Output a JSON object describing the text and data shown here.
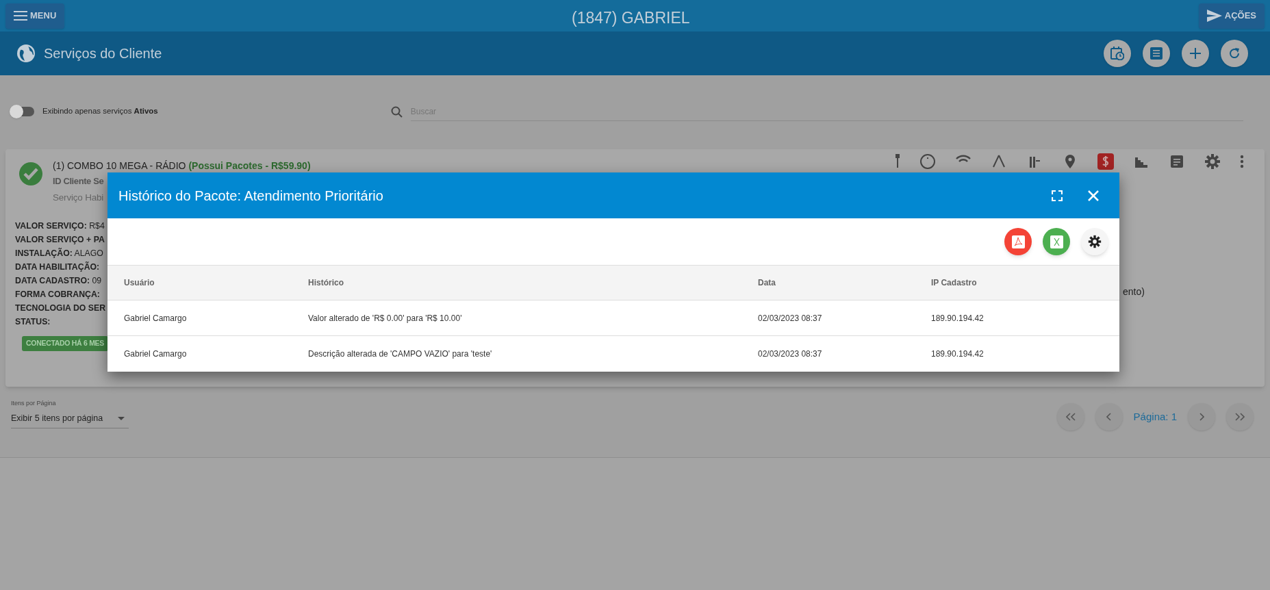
{
  "top_bar": {
    "menu_button": "MENU",
    "title": "(1847) GABRIEL",
    "actions_button": "AÇÕES"
  },
  "header": {
    "title": "Serviços do Cliente"
  },
  "filter": {
    "toggle": {
      "on": false
    },
    "label": "Exibindo apenas serviços **Ativos**",
    "search": {
      "placeholder": "Buscar"
    }
  },
  "service_card": {
    "title": "(1) COMBO 10 MEGA - RÁDIO",
    "package_note": "(Possui Pacotes - R$59.90)",
    "subtitle": "ID Cliente Se",
    "line": "Serviço Habi",
    "details": [
      {
        "label": "VALOR SERVIÇO:",
        "value": "R$4"
      },
      {
        "label": "VALOR SERVIÇO + PA"
      },
      {
        "label": "INSTALAÇÃO:",
        "value": "ALAGO"
      },
      {
        "label": "DATA HABILITAÇÃO:"
      },
      {
        "label": "DATA CADASTRO:",
        "value": "09"
      },
      {
        "label": "FORMA COBRANÇA:"
      },
      {
        "label": "TECNOLOGIA DO SER"
      },
      {
        "label": "STATUS:"
      }
    ],
    "badge": "CONECTADO HÁ 6 MES",
    "side_text": "ento)"
  },
  "modal": {
    "title": "Histórico do Pacote: Atendimento Prioritário",
    "table": {
      "columns": [
        "Usuário",
        "Histórico",
        "Data",
        "IP Cadastro"
      ],
      "rows": [
        [
          "Gabriel Camargo",
          "Valor alterado de 'R$ 0.00' para 'R$ 10.00'",
          "02/03/2023 08:37",
          "189.90.194.42"
        ],
        [
          "Gabriel Camargo",
          "Descrição alterada de 'CAMPO VAZIO' para 'teste'",
          "02/03/2023 08:37",
          "189.90.194.42"
        ]
      ]
    }
  },
  "pagination": {
    "per_page_label": "Itens por Página",
    "per_page_value": "Exibir 5 itens por página",
    "page_label": "Página: 1"
  }
}
